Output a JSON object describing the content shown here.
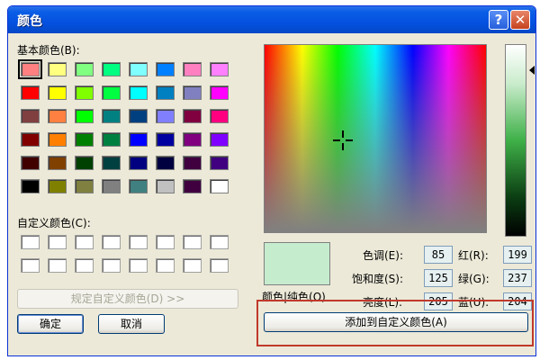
{
  "window": {
    "title": "颜色",
    "help_glyph": "?",
    "close_glyph": "✕"
  },
  "basic_colors": {
    "label": "基本颜色(B):",
    "colors": [
      "#ff8080",
      "#ffff80",
      "#80ff80",
      "#00ff80",
      "#80ffff",
      "#0080ff",
      "#ff80c0",
      "#ff80ff",
      "#ff0000",
      "#ffff00",
      "#80ff00",
      "#00ff40",
      "#00ffff",
      "#0080c0",
      "#8080c0",
      "#ff00ff",
      "#804040",
      "#ff8040",
      "#00ff00",
      "#008080",
      "#004080",
      "#8080ff",
      "#800040",
      "#ff0080",
      "#800000",
      "#ff8000",
      "#008000",
      "#008040",
      "#0000ff",
      "#0000a0",
      "#800080",
      "#8000ff",
      "#400000",
      "#804000",
      "#004000",
      "#004040",
      "#000080",
      "#000040",
      "#400040",
      "#400080",
      "#000000",
      "#808000",
      "#808040",
      "#808080",
      "#408080",
      "#c0c0c0",
      "#400040",
      "#ffffff"
    ],
    "selected_index": 0
  },
  "custom_colors": {
    "label": "自定义颜色(C):",
    "count": 16
  },
  "buttons": {
    "define_custom": "规定自定义颜色(D) >>",
    "ok": "确定",
    "cancel": "取消",
    "add_custom": "添加到自定义颜色(A)"
  },
  "preview": {
    "label": "颜色|纯色(O)",
    "color": "#c6ecce"
  },
  "fields": {
    "hue": {
      "label": "色调(E):",
      "value": "85"
    },
    "sat": {
      "label": "饱和度(S):",
      "value": "125"
    },
    "lum": {
      "label": "亮度(L):",
      "value": "205"
    },
    "red": {
      "label": "红(R):",
      "value": "199"
    },
    "green": {
      "label": "绿(G):",
      "value": "237"
    },
    "blue": {
      "label": "蓝(U):",
      "value": "204"
    }
  },
  "colors": {
    "titlebar": "#0551e0",
    "dialog_bg": "#ece9d8",
    "highlight_box": "#c0392b"
  }
}
